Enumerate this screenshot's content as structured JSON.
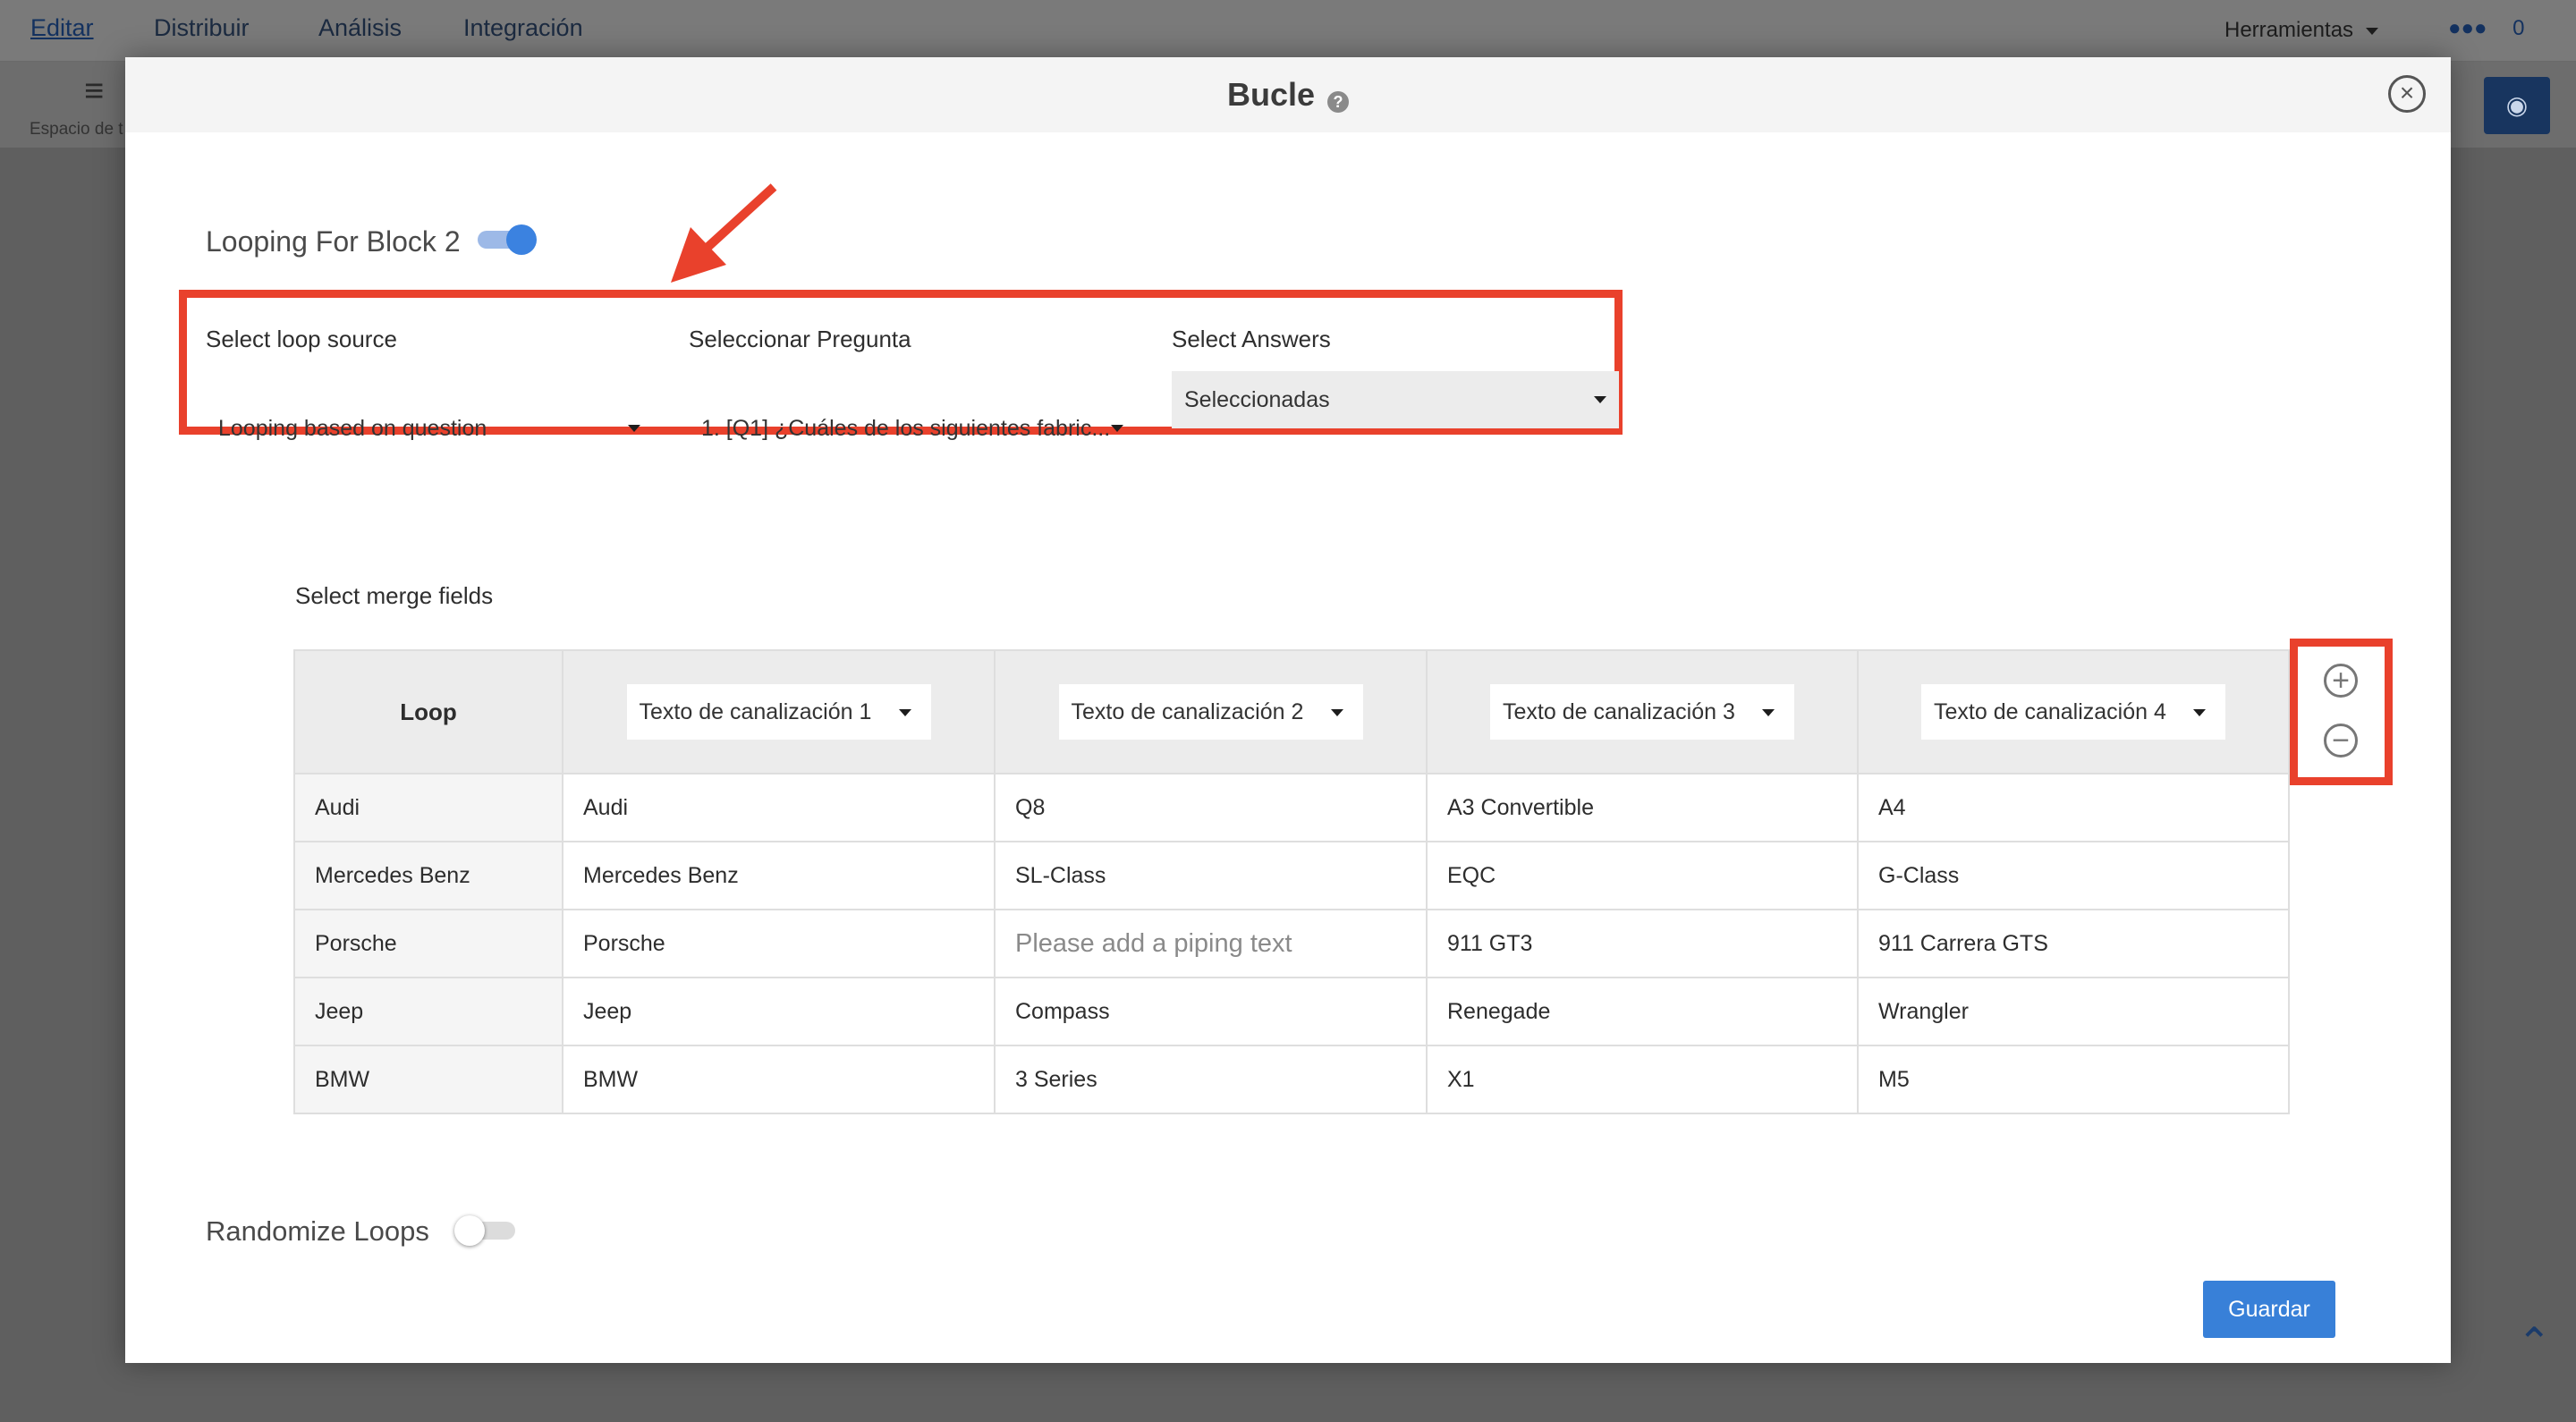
{
  "topnav": {
    "tabs": [
      "Editar",
      "Distribuir",
      "Análisis",
      "Integración"
    ],
    "tools_label": "Herramientas",
    "people_count": "0"
  },
  "subbar": {
    "workspace_label": "Espacio de t"
  },
  "modal": {
    "title": "Bucle",
    "help_icon": "?",
    "close_icon": "×",
    "looping_label": "Looping For Block 2",
    "looping_enabled": true,
    "loop_source": {
      "label": "Select loop source",
      "value": "Looping based on question"
    },
    "question": {
      "label": "Seleccionar Pregunta",
      "value": "1. [Q1] ¿Cuáles de los siguientes fabric..."
    },
    "answers": {
      "label": "Select Answers",
      "value": "Seleccionadas"
    },
    "merge_label": "Select merge fields",
    "table": {
      "loop_header": "Loop",
      "columns": [
        "Texto de canalización 1",
        "Texto de canalización 2",
        "Texto de canalización 3",
        "Texto de canalización 4"
      ],
      "rows": [
        {
          "loop": "Audi",
          "cells": [
            "Audi",
            "Q8",
            "A3 Convertible",
            "A4"
          ]
        },
        {
          "loop": "Mercedes Benz",
          "cells": [
            "Mercedes Benz",
            "SL-Class",
            "EQC",
            "G-Class"
          ]
        },
        {
          "loop": "Porsche",
          "cells": [
            "Porsche",
            "Please add a piping text",
            "911 GT3",
            "911 Carrera GTS"
          ]
        },
        {
          "loop": "Jeep",
          "cells": [
            "Jeep",
            "Compass",
            "Renegade",
            "Wrangler"
          ]
        },
        {
          "loop": "BMW",
          "cells": [
            "BMW",
            "3 Series",
            "X1",
            "M5"
          ]
        }
      ]
    },
    "plus_icon": "+",
    "minus_icon": "−",
    "randomize_label": "Randomize Loops",
    "randomize_enabled": false,
    "save_label": "Guardar"
  },
  "colors": {
    "accent": "#3880d8",
    "highlight": "#e9412c",
    "toggle_on": "#3b82e0"
  }
}
